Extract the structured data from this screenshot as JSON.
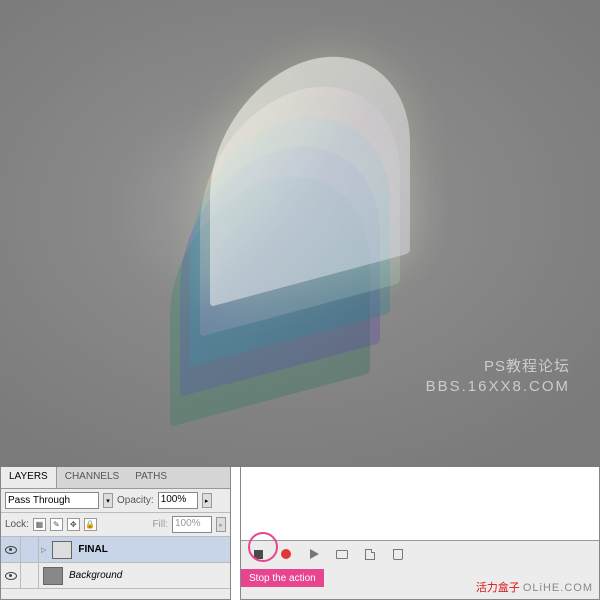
{
  "watermarks": {
    "top_line1": "PS教程论坛",
    "top_line2": "BBS.16XX8.COM",
    "bottom_red": "活力盒子",
    "bottom_gray": "OLiHE.COM"
  },
  "layers_panel": {
    "tabs": [
      "LAYERS",
      "CHANNELS",
      "PATHS"
    ],
    "blend_mode": "Pass Through",
    "opacity_label": "Opacity:",
    "opacity_value": "100%",
    "lock_label": "Lock:",
    "fill_label": "Fill:",
    "fill_value": "100%",
    "rows": [
      {
        "name": "FINAL",
        "type": "folder",
        "bold": true
      },
      {
        "name": "Background",
        "type": "bg",
        "italic": true
      }
    ]
  },
  "actions_panel": {
    "callout": "Stop the action",
    "icons": [
      "stop",
      "record",
      "play",
      "new-folder",
      "new-action",
      "delete"
    ]
  }
}
